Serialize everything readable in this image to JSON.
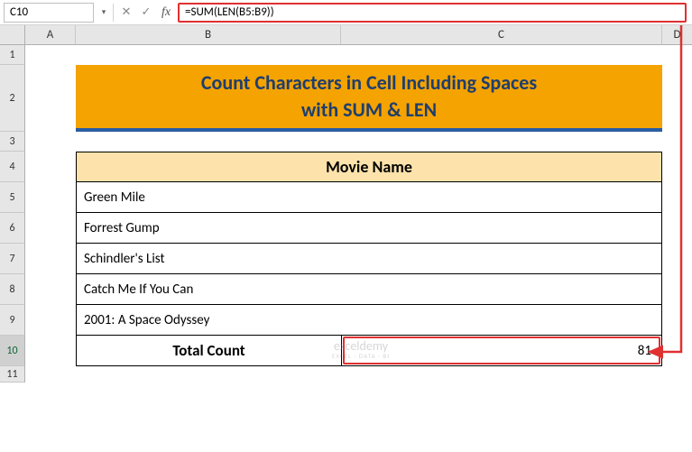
{
  "nameBox": "C10",
  "formula": "=SUM(LEN(B5:B9))",
  "columns": {
    "A": "A",
    "B": "B",
    "C": "C",
    "D": "D"
  },
  "rows": [
    "1",
    "2",
    "3",
    "4",
    "5",
    "6",
    "7",
    "8",
    "9",
    "10",
    "11"
  ],
  "title": {
    "line1": "Count Characters in Cell Including Spaces",
    "line2": "with SUM & LEN"
  },
  "header": "Movie Name",
  "movies": [
    "Green Mile",
    "Forrest Gump",
    "Schindler's List",
    "Catch  Me If You Can",
    "2001: A Space Odyssey"
  ],
  "total": {
    "label": "Total Count",
    "value": "81"
  },
  "watermark": {
    "line1": "exceldemy",
    "line2": "EXCEL · DATA · BI"
  },
  "icons": {
    "dropdown": "▾",
    "cancel": "✕",
    "confirm": "✓",
    "fx": "fx"
  }
}
